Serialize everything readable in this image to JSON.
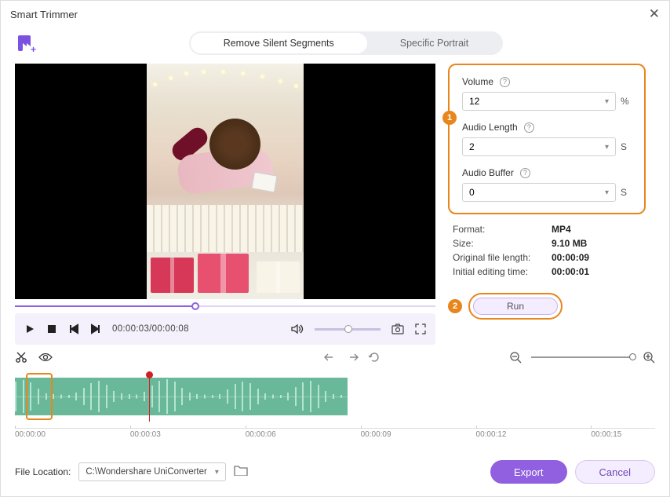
{
  "window": {
    "title": "Smart Trimmer"
  },
  "tabs": {
    "remove_silent": "Remove Silent Segments",
    "specific_portrait": "Specific Portrait"
  },
  "playback": {
    "time": "00:00:03/00:00:08"
  },
  "settings": {
    "volume_label": "Volume",
    "volume_value": "12",
    "volume_unit": "%",
    "audio_length_label": "Audio Length",
    "audio_length_value": "2",
    "audio_length_unit": "S",
    "audio_buffer_label": "Audio Buffer",
    "audio_buffer_value": "0",
    "audio_buffer_unit": "S"
  },
  "meta": {
    "format_k": "Format:",
    "format_v": "MP4",
    "size_k": "Size:",
    "size_v": "9.10 MB",
    "orig_k": "Original file length:",
    "orig_v": "00:00:09",
    "init_k": "Initial editing time:",
    "init_v": "00:00:01"
  },
  "callouts": {
    "one": "1",
    "two": "2"
  },
  "run": {
    "label": "Run"
  },
  "ruler": {
    "t0": "00:00:00",
    "t1": "00:00:03",
    "t2": "00:00:06",
    "t3": "00:00:09",
    "t4": "00:00:12",
    "t5": "00:00:15"
  },
  "footer": {
    "label": "File Location:",
    "path": "C:\\Wondershare UniConverter",
    "export": "Export",
    "cancel": "Cancel"
  }
}
